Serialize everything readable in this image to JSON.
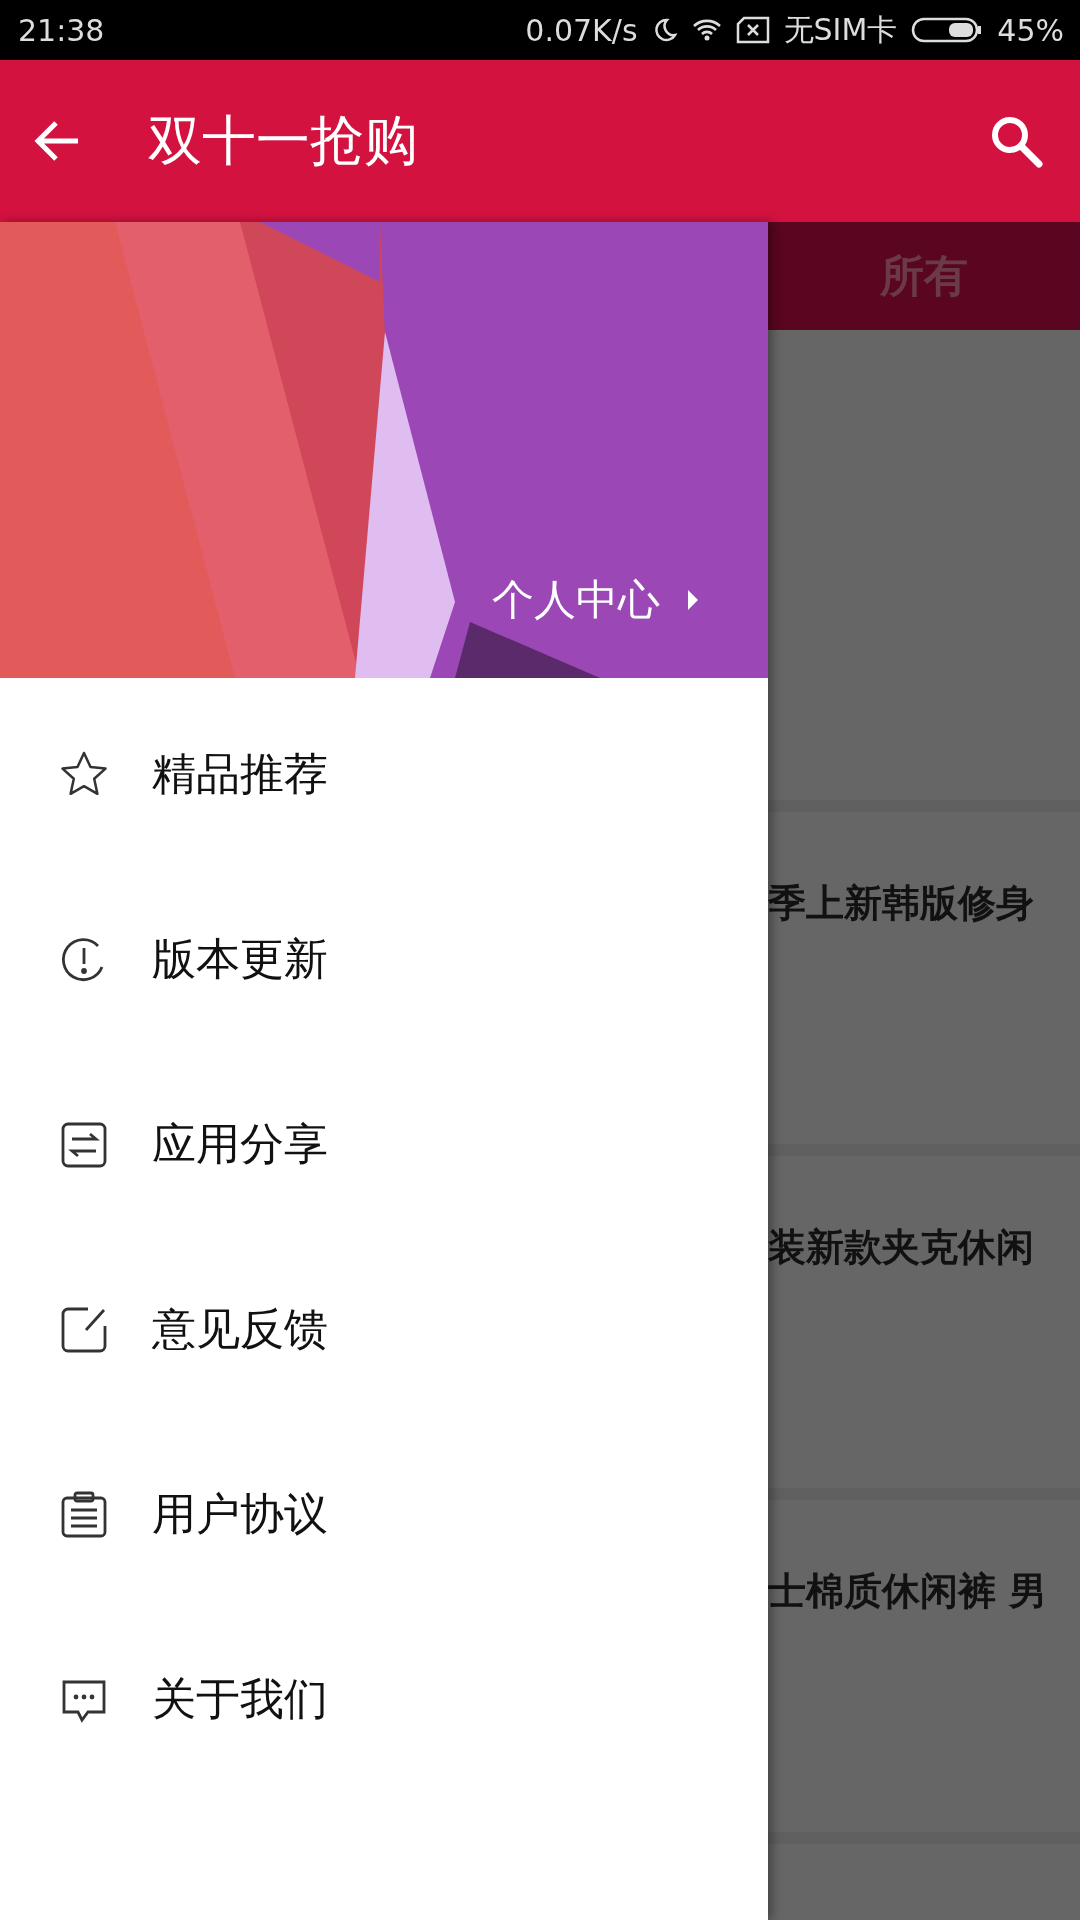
{
  "status_bar": {
    "time": "21:38",
    "speed": "0.07K/s",
    "sim": "无SIM卡",
    "battery": "45%"
  },
  "app_bar": {
    "title": "双十一抢购"
  },
  "background": {
    "tab": "所有",
    "cards": [
      {
        "title": "季上新韩版修身"
      },
      {
        "title": "装新款夹克休闲"
      },
      {
        "title": "士棉质休闲裤 男"
      }
    ]
  },
  "drawer": {
    "header": {
      "link": "个人中心"
    },
    "items": [
      {
        "label": "精品推荐"
      },
      {
        "label": "版本更新"
      },
      {
        "label": "应用分享"
      },
      {
        "label": "意见反馈"
      },
      {
        "label": "用户协议"
      },
      {
        "label": "关于我们"
      }
    ]
  }
}
